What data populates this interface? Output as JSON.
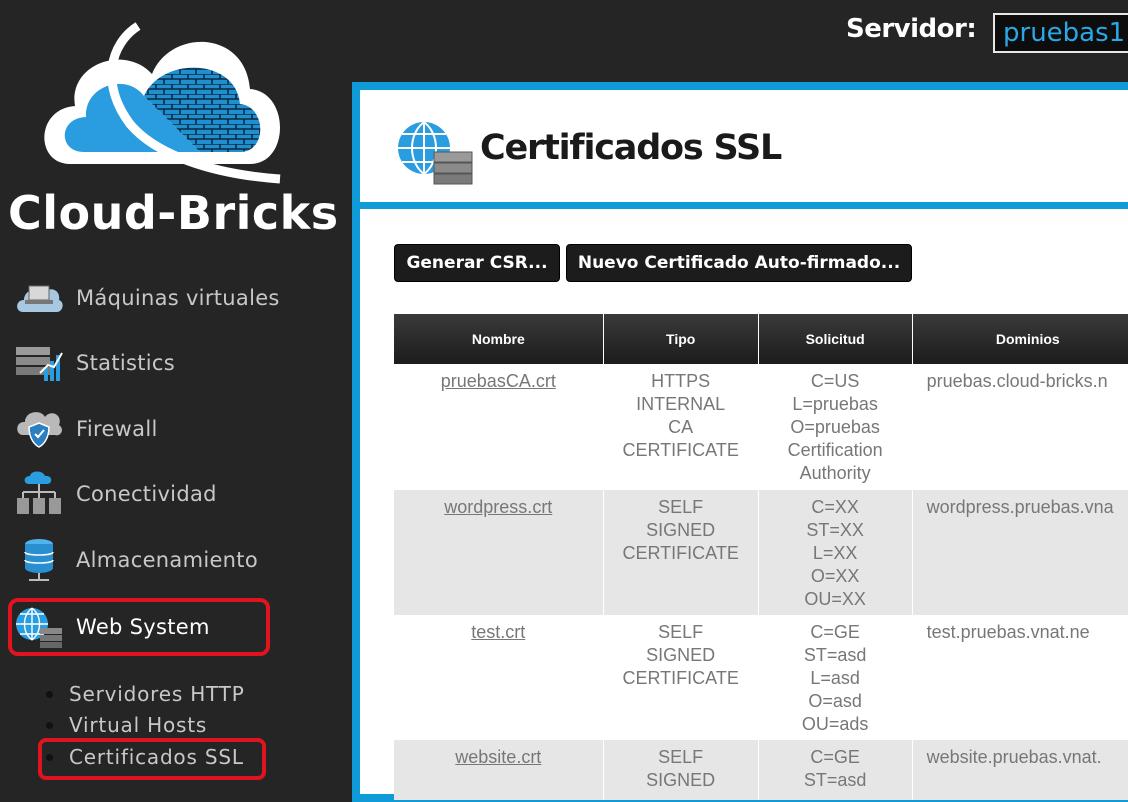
{
  "brand": "Cloud-Bricks",
  "server": {
    "label": "Servidor:",
    "value": "pruebas1"
  },
  "nav": [
    {
      "label": "Máquinas virtuales",
      "icon": "cloud-computer-icon"
    },
    {
      "label": "Statistics",
      "icon": "server-chart-icon"
    },
    {
      "label": "Firewall",
      "icon": "shield-cloud-icon"
    },
    {
      "label": "Conectividad",
      "icon": "network-icon"
    },
    {
      "label": "Almacenamiento",
      "icon": "database-icon"
    },
    {
      "label": "Web System",
      "icon": "globe-server-icon",
      "active": true
    }
  ],
  "subnav": [
    {
      "label": "Servidores HTTP"
    },
    {
      "label": "Virtual Hosts"
    },
    {
      "label": "Certificados SSL",
      "active": true
    }
  ],
  "page": {
    "title": "Certificados SSL"
  },
  "buttons": {
    "generate_csr": "Generar CSR...",
    "new_self_signed": "Nuevo Certificado Auto-firmado..."
  },
  "table": {
    "columns": [
      "Nombre",
      "Tipo",
      "Solicitud",
      "Dominios"
    ],
    "rows": [
      {
        "name": "pruebasCA.crt",
        "type": [
          "HTTPS",
          "INTERNAL",
          "CA",
          "CERTIFICATE"
        ],
        "request": [
          "C=US",
          "L=pruebas",
          "O=pruebas",
          "Certification",
          "Authority"
        ],
        "domains": "pruebas.cloud-bricks.n"
      },
      {
        "name": "wordpress.crt",
        "type": [
          "SELF",
          "SIGNED",
          "CERTIFICATE"
        ],
        "request": [
          "C=XX",
          "ST=XX",
          "L=XX",
          "O=XX",
          "OU=XX"
        ],
        "domains": "wordpress.pruebas.vna"
      },
      {
        "name": "test.crt",
        "type": [
          "SELF",
          "SIGNED",
          "CERTIFICATE"
        ],
        "request": [
          "C=GE",
          "ST=asd",
          "L=asd",
          "O=asd",
          "OU=ads"
        ],
        "domains": "test.pruebas.vnat.ne"
      },
      {
        "name": "website.crt",
        "type": [
          "SELF",
          "SIGNED"
        ],
        "request": [
          "C=GE",
          "ST=asd"
        ],
        "domains": "website.pruebas.vnat."
      }
    ]
  },
  "colors": {
    "accent": "#0f9ad8",
    "highlight": "#e0141e",
    "sidebar": "#252525"
  }
}
